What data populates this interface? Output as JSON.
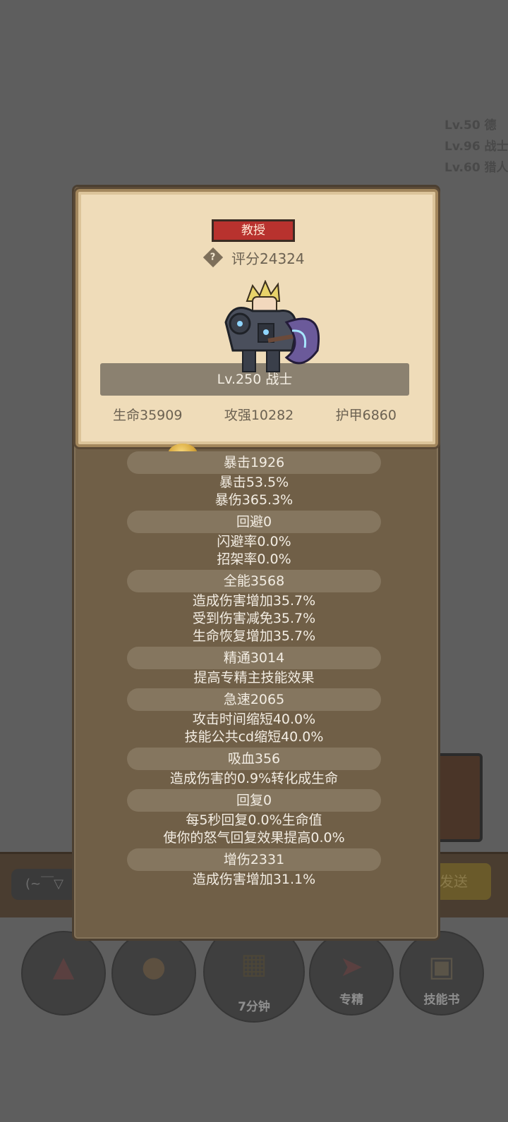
{
  "background": {
    "log_lines": [
      "Lv.50 德",
      "Lv.96 战士",
      "Lv.60 猎人"
    ],
    "chat_placeholder": "(~￣▽",
    "send_label": "发送",
    "slots": [
      {
        "icon": "potion-icon",
        "label": ""
      },
      {
        "icon": "bread-icon",
        "label": ""
      },
      {
        "icon": "bookshelf-icon",
        "label": "7分钟"
      },
      {
        "icon": "specialize-icon",
        "label": "专精"
      },
      {
        "icon": "skillbook-icon",
        "label": "技能书"
      }
    ]
  },
  "card": {
    "rank": "教授",
    "score": "评分24324",
    "level_class": "Lv.250 战士",
    "hp": "生命35909",
    "attack": "攻强10282",
    "armor": "护甲6860"
  },
  "stats": [
    {
      "header": "暴击1926",
      "lines": [
        "暴击53.5%",
        "暴伤365.3%"
      ]
    },
    {
      "header": "回避0",
      "lines": [
        "闪避率0.0%",
        "招架率0.0%"
      ]
    },
    {
      "header": "全能3568",
      "lines": [
        "造成伤害增加35.7%",
        "受到伤害减免35.7%",
        "生命恢复增加35.7%"
      ]
    },
    {
      "header": "精通3014",
      "lines": [
        "提高专精主技能效果"
      ]
    },
    {
      "header": "急速2065",
      "lines": [
        "攻击时间缩短40.0%",
        "技能公共cd缩短40.0%"
      ]
    },
    {
      "header": "吸血356",
      "lines": [
        "造成伤害的0.9%转化成生命"
      ]
    },
    {
      "header": "回复0",
      "lines": [
        "每5秒回复0.0%生命值",
        "使你的怒气回复效果提高0.0%"
      ]
    },
    {
      "header": "增伤2331",
      "lines": [
        "造成伤害增加31.1%"
      ]
    }
  ],
  "colors": {
    "overlay": "#5e5e5e",
    "panel": "#705f47",
    "card": "#efdcb9",
    "rank_badge": "#b8322e"
  }
}
